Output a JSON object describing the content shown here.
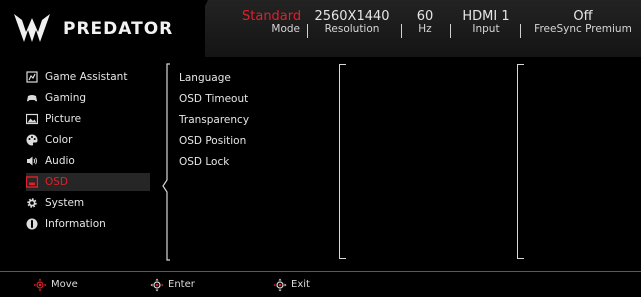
{
  "header": {
    "brand": "PREDATOR",
    "items": [
      {
        "value": "Standard",
        "label": "Mode"
      },
      {
        "value": "2560X1440",
        "label": "Resolution"
      },
      {
        "value": "60",
        "label": "Hz"
      },
      {
        "value": "HDMI 1",
        "label": "Input"
      },
      {
        "value": "Off",
        "label": "FreeSync Premium"
      }
    ]
  },
  "sidebar": {
    "items": [
      {
        "label": "Game Assistant",
        "icon": "game-assistant-icon"
      },
      {
        "label": "Gaming",
        "icon": "gamepad-icon"
      },
      {
        "label": "Picture",
        "icon": "picture-icon"
      },
      {
        "label": "Color",
        "icon": "palette-icon"
      },
      {
        "label": "Audio",
        "icon": "speaker-icon"
      },
      {
        "label": "OSD",
        "icon": "osd-icon"
      },
      {
        "label": "System",
        "icon": "gear-icon"
      },
      {
        "label": "Information",
        "icon": "info-icon"
      }
    ],
    "selected": "OSD"
  },
  "submenu": {
    "items": [
      "Language",
      "OSD Timeout",
      "Transparency",
      "OSD Position",
      "OSD Lock"
    ]
  },
  "footer": {
    "move": "Move",
    "enter": "Enter",
    "exit": "Exit"
  },
  "colors": {
    "accent": "#e0202a",
    "text": "#e6e6e6",
    "background": "#000000",
    "header": "#1c1c1c"
  }
}
